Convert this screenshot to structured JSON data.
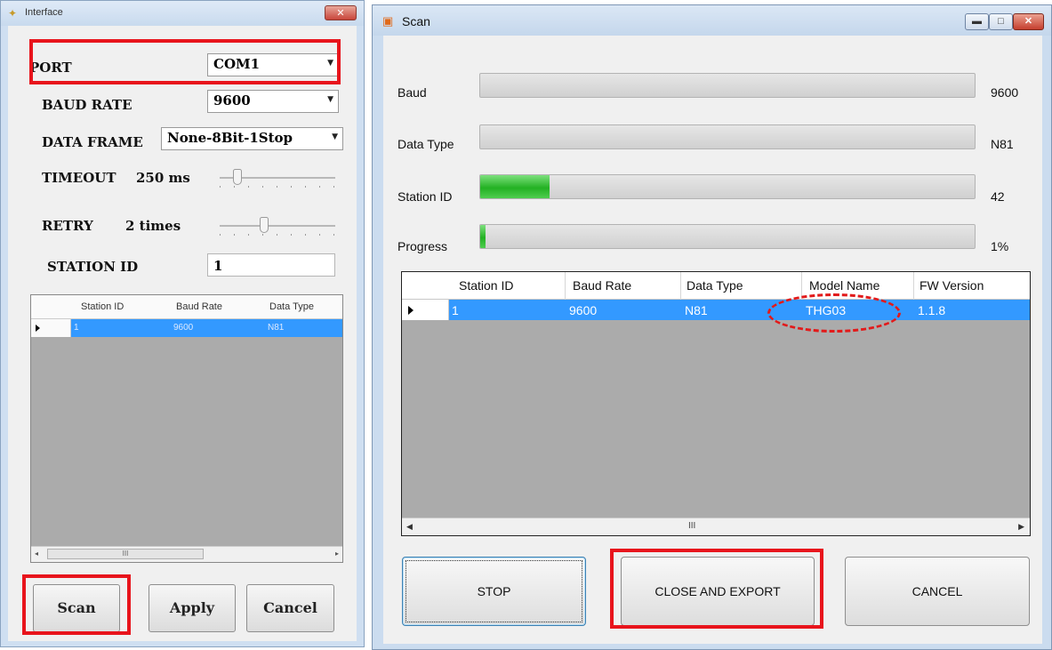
{
  "interface_window": {
    "title": "Interface",
    "close_glyph": "✕",
    "port_label": "PORT",
    "port_value": "COM1",
    "baud_label": "BAUD RATE",
    "baud_value": "9600",
    "frame_label": "DATA FRAME",
    "frame_value": "None-8Bit-1Stop",
    "timeout_label": "TIMEOUT",
    "timeout_value": "250 ms",
    "retry_label": "RETRY",
    "retry_value": "2 times",
    "station_label": "STATION ID",
    "station_value": "1",
    "grid": {
      "columns": [
        "Station ID",
        "Baud Rate",
        "Data Type"
      ],
      "row": [
        "1",
        "9600",
        "N81"
      ],
      "scroll_grip": "III"
    },
    "buttons": {
      "scan": "Scan",
      "apply": "Apply",
      "cancel": "Cancel"
    }
  },
  "scan_window": {
    "title": "Scan",
    "caption_buttons": {
      "minimize": "▬",
      "maximize": "□",
      "close": "✕"
    },
    "rows": [
      {
        "label": "Baud",
        "value": "9600",
        "fill": 0.0
      },
      {
        "label": "Data Type",
        "value": "N81",
        "fill": 0.0
      },
      {
        "label": "Station ID",
        "value": "42",
        "fill": 0.14
      },
      {
        "label": "Progress",
        "value": "1%",
        "fill": 0.01
      }
    ],
    "grid": {
      "columns": [
        "Station ID",
        "Baud Rate",
        "Data Type",
        "Model Name",
        "FW Version"
      ],
      "row": [
        "1",
        "9600",
        "N81",
        "THG03",
        "1.1.8"
      ],
      "scroll_grip": "III"
    },
    "buttons": {
      "stop": "STOP",
      "close_export": "CLOSE AND EXPORT",
      "cancel": "CANCEL"
    }
  },
  "colors": {
    "highlight_red": "#e8141c",
    "selection_blue": "#3399ff",
    "progress_green": "#23b123"
  },
  "icons": [
    "interface-app-icon",
    "scan-app-icon",
    "dropdown-arrow-icon",
    "row-pointer-icon"
  ]
}
